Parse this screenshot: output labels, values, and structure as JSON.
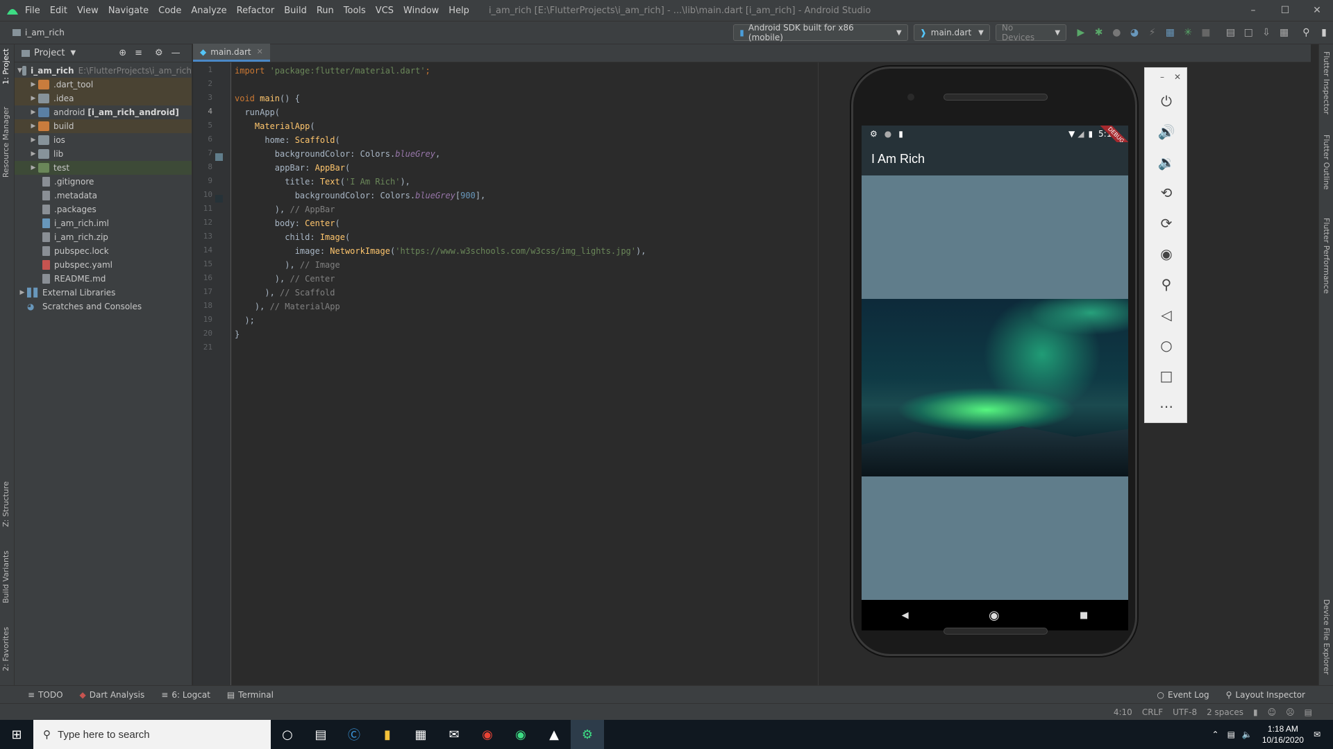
{
  "window": {
    "menu": [
      "File",
      "Edit",
      "View",
      "Navigate",
      "Code",
      "Analyze",
      "Refactor",
      "Build",
      "Run",
      "Tools",
      "VCS",
      "Window",
      "Help"
    ],
    "title": "i_am_rich [E:\\FlutterProjects\\i_am_rich] - ...\\lib\\main.dart [i_am_rich] - Android Studio"
  },
  "navbar": {
    "breadcrumb": "i_am_rich",
    "device_target": "Android SDK built for x86 (mobile)",
    "run_config": "main.dart",
    "devices": "No Devices"
  },
  "left_tabs": [
    "1: Project",
    "Resource Manager",
    "Z: Structure",
    "Build Variants",
    "2: Favorites"
  ],
  "right_tabs": [
    "Flutter Inspector",
    "Flutter Outline",
    "Flutter Performance",
    "Device File Explorer"
  ],
  "project": {
    "header": "Project",
    "root_name": "i_am_rich",
    "root_path": "E:\\FlutterProjects\\i_am_rich",
    "items": [
      {
        "label": ".dart_tool"
      },
      {
        "label": ".idea"
      },
      {
        "label": "android",
        "bold": "[i_am_rich_android]"
      },
      {
        "label": "build"
      },
      {
        "label": "ios"
      },
      {
        "label": "lib"
      },
      {
        "label": "test"
      },
      {
        "label": ".gitignore"
      },
      {
        "label": ".metadata"
      },
      {
        "label": ".packages"
      },
      {
        "label": "i_am_rich.iml"
      },
      {
        "label": "i_am_rich.zip"
      },
      {
        "label": "pubspec.lock"
      },
      {
        "label": "pubspec.yaml"
      },
      {
        "label": "README.md"
      },
      {
        "label": "External Libraries"
      },
      {
        "label": "Scratches and Consoles"
      }
    ]
  },
  "editor": {
    "tab": "main.dart",
    "line_numbers": [
      "1",
      "2",
      "3",
      "4",
      "5",
      "6",
      "7",
      "8",
      "9",
      "10",
      "11",
      "12",
      "13",
      "14",
      "15",
      "16",
      "17",
      "18",
      "19",
      "20",
      "21"
    ],
    "current_line": "4"
  },
  "emulator": {
    "status_time": "5:18",
    "app_title": "I Am Rich",
    "debug_banner": "DEBUG"
  },
  "bottom_tools": [
    "TODO",
    "Dart Analysis",
    "6: Logcat",
    "Terminal"
  ],
  "bottom_right_tools": [
    "Event Log",
    "Layout Inspector"
  ],
  "status": {
    "position": "4:10",
    "line_sep": "CRLF",
    "encoding": "UTF-8",
    "indent": "2 spaces"
  },
  "taskbar": {
    "search_placeholder": "Type here to search",
    "time": "1:18 AM",
    "date": "10/16/2020"
  }
}
